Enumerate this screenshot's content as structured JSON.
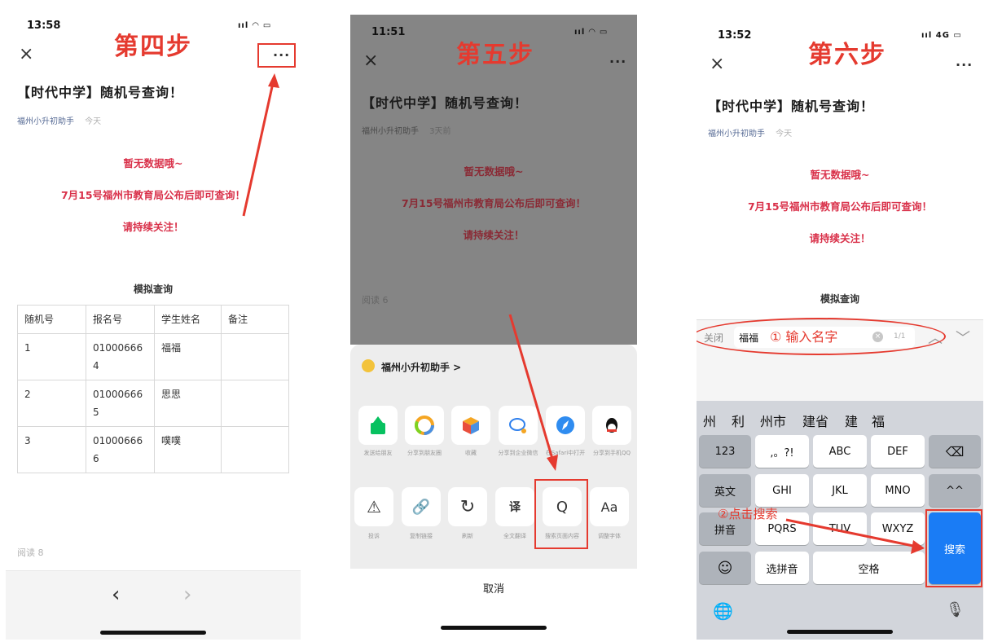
{
  "phone1": {
    "time": "13:58",
    "signal": "ııl ◠ ▭",
    "step": "第四步",
    "close": "×",
    "more": "···",
    "title": "【时代中学】随机号查询！",
    "author": "福州小升初助手",
    "date": "今天",
    "msg1": "暂无数据哦~",
    "msg2": "7月15号福州市教育局公布后即可查询！",
    "msg3": "请持续关注！",
    "table_title": "模拟查询",
    "table": {
      "headers": [
        "随机号",
        "报名号",
        "学生姓名",
        "备注"
      ],
      "rows": [
        [
          "1",
          "010006664",
          "福福",
          ""
        ],
        [
          "2",
          "010006665",
          "思思",
          ""
        ],
        [
          "3",
          "010006666",
          "噗噗",
          ""
        ]
      ]
    },
    "reads": "阅读 8",
    "nav_back": "‹",
    "nav_fwd": "›"
  },
  "phone2": {
    "time": "11:51",
    "signal": "ııl ◠ ▭",
    "step": "第五步",
    "close": "×",
    "more": "···",
    "title": "【时代中学】随机号查询！",
    "author": "福州小升初助手",
    "date": "3天前",
    "msg1": "暂无数据哦~",
    "msg2": "7月15号福州市教育局公布后即可查询！",
    "msg3": "请持续关注！",
    "reads": "阅读 6",
    "sheet_account": "福州小升初助手 >",
    "share_row": [
      {
        "label": "发送给朋友",
        "icon": "send-to-friend-icon"
      },
      {
        "label": "分享到朋友圈",
        "icon": "moments-icon"
      },
      {
        "label": "收藏",
        "icon": "favorites-icon"
      },
      {
        "label": "分享到企业微信",
        "icon": "wecom-icon"
      },
      {
        "label": "在Safari中打开",
        "icon": "safari-icon"
      },
      {
        "label": "分享到手机QQ",
        "icon": "qq-icon"
      }
    ],
    "action_row": [
      {
        "label": "投诉",
        "icon": "warning-icon",
        "glyph": "⚠"
      },
      {
        "label": "复制链接",
        "icon": "link-icon",
        "glyph": "🔗"
      },
      {
        "label": "刷新",
        "icon": "refresh-icon",
        "glyph": "↻"
      },
      {
        "label": "全文翻译",
        "icon": "translate-icon",
        "glyph": "译"
      },
      {
        "label": "搜索页面内容",
        "icon": "search-icon",
        "glyph": "Q"
      },
      {
        "label": "调整字体",
        "icon": "font-size-icon",
        "glyph": "Aa"
      }
    ],
    "cancel": "取消"
  },
  "phone3": {
    "time": "13:52",
    "signal": "ııl 4G ▭",
    "step": "第六步",
    "close": "×",
    "more": "···",
    "title": "【时代中学】随机号查询！",
    "author": "福州小升初助手",
    "date": "今天",
    "msg1": "暂无数据哦~",
    "msg2": "7月15号福州市教育局公布后即可查询！",
    "msg3": "请持续关注！",
    "table_title": "模拟查询",
    "search_close": "关闭",
    "search_value": "福福",
    "search_count": "1/1",
    "annot1": "① 输入名字",
    "annot2": "②点击搜索",
    "candidates": [
      "州",
      "利",
      "州市",
      "建省",
      "建",
      "福"
    ],
    "keys": {
      "k123": "123",
      "punct": ",。?!",
      "abc": "ABC",
      "def": "DEF",
      "del": "⌫",
      "en": "英文",
      "ghi": "GHI",
      "jkl": "JKL",
      "mno": "MNO",
      "caret": "^^",
      "pinyin": "拼音",
      "pqrs": "PQRS",
      "tuv": "TUV",
      "wxyz": "WXYZ",
      "emoji": "☺",
      "xuan": "选拼音",
      "space": "空格",
      "search": "搜索",
      "globe": "🌐",
      "mic": "🎙"
    }
  }
}
